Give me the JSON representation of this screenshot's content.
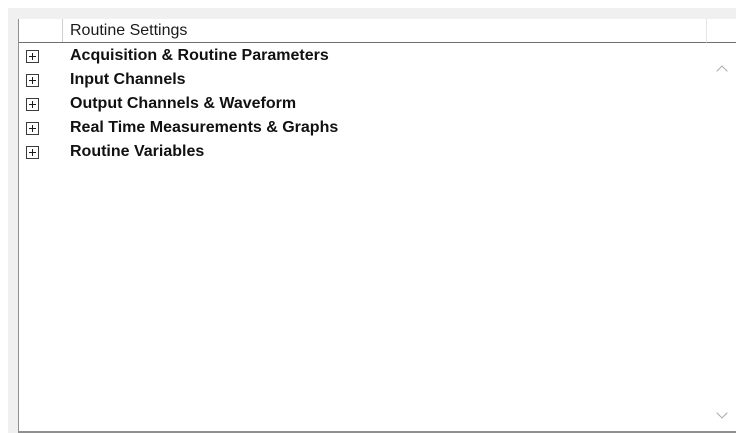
{
  "panel": {
    "header_label": "Routine Settings"
  },
  "tree": {
    "items": [
      {
        "label": "Acquisition & Routine Parameters",
        "icon": "expand-plus-icon"
      },
      {
        "label": "Input Channels",
        "icon": "expand-plus-icon"
      },
      {
        "label": "Output Channels & Waveform",
        "icon": "expand-plus-icon"
      },
      {
        "label": "Real Time Measurements & Graphs",
        "icon": "expand-plus-icon"
      },
      {
        "label": "Routine Variables",
        "icon": "expand-plus-icon"
      }
    ]
  },
  "scrollbar": {
    "up_icon": "chevron-up-icon",
    "down_icon": "chevron-down-icon"
  }
}
